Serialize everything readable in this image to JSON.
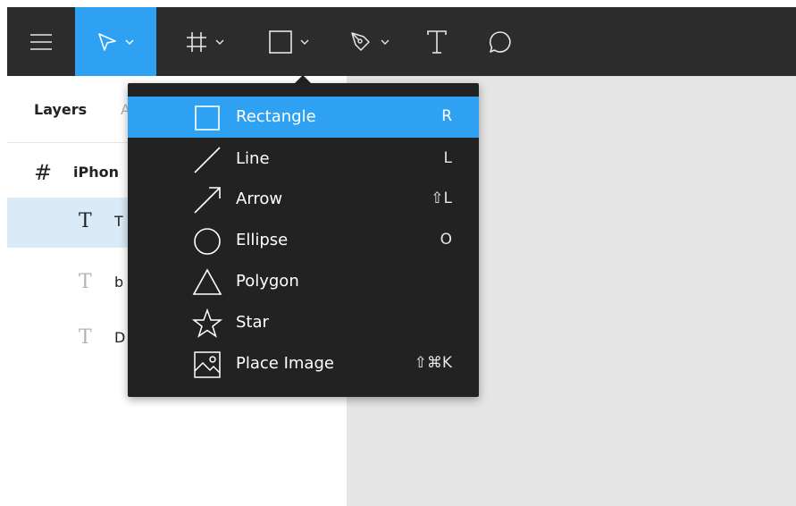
{
  "toolbar": {
    "menu_icon": "hamburger-icon",
    "tools": [
      {
        "name": "move",
        "icon": "cursor-icon",
        "active": true
      },
      {
        "name": "frame",
        "icon": "frame-hash-icon"
      },
      {
        "name": "shape",
        "icon": "rectangle-icon"
      },
      {
        "name": "pen",
        "icon": "pen-icon"
      },
      {
        "name": "text",
        "icon": "text-icon"
      },
      {
        "name": "comment",
        "icon": "comment-icon"
      }
    ]
  },
  "layers_panel": {
    "tabs": [
      "Layers",
      "A"
    ],
    "layers": [
      {
        "icon": "#",
        "label": "iPhon",
        "type": "frame"
      },
      {
        "icon": "T",
        "label": "T",
        "type": "text",
        "selected": true
      },
      {
        "icon": "T",
        "label": "b",
        "type": "text"
      },
      {
        "icon": "T",
        "label": "D",
        "type": "text"
      }
    ]
  },
  "shape_menu": {
    "items": [
      {
        "label": "Rectangle",
        "shortcut": "R",
        "icon": "rectangle-icon",
        "active": true
      },
      {
        "label": "Line",
        "shortcut": "L",
        "icon": "line-icon"
      },
      {
        "label": "Arrow",
        "shortcut": "⇧L",
        "icon": "arrow-icon"
      },
      {
        "label": "Ellipse",
        "shortcut": "O",
        "icon": "ellipse-icon"
      },
      {
        "label": "Polygon",
        "shortcut": "",
        "icon": "polygon-icon"
      },
      {
        "label": "Star",
        "shortcut": "",
        "icon": "star-icon"
      },
      {
        "label": "Place Image",
        "shortcut": "⇧⌘K",
        "icon": "image-icon"
      }
    ]
  },
  "colors": {
    "toolbar_bg": "#2c2c2c",
    "accent": "#2fa1f3",
    "menu_bg": "#222222",
    "canvas_bg": "#e5e5e5",
    "selected_row": "#daebf7"
  }
}
